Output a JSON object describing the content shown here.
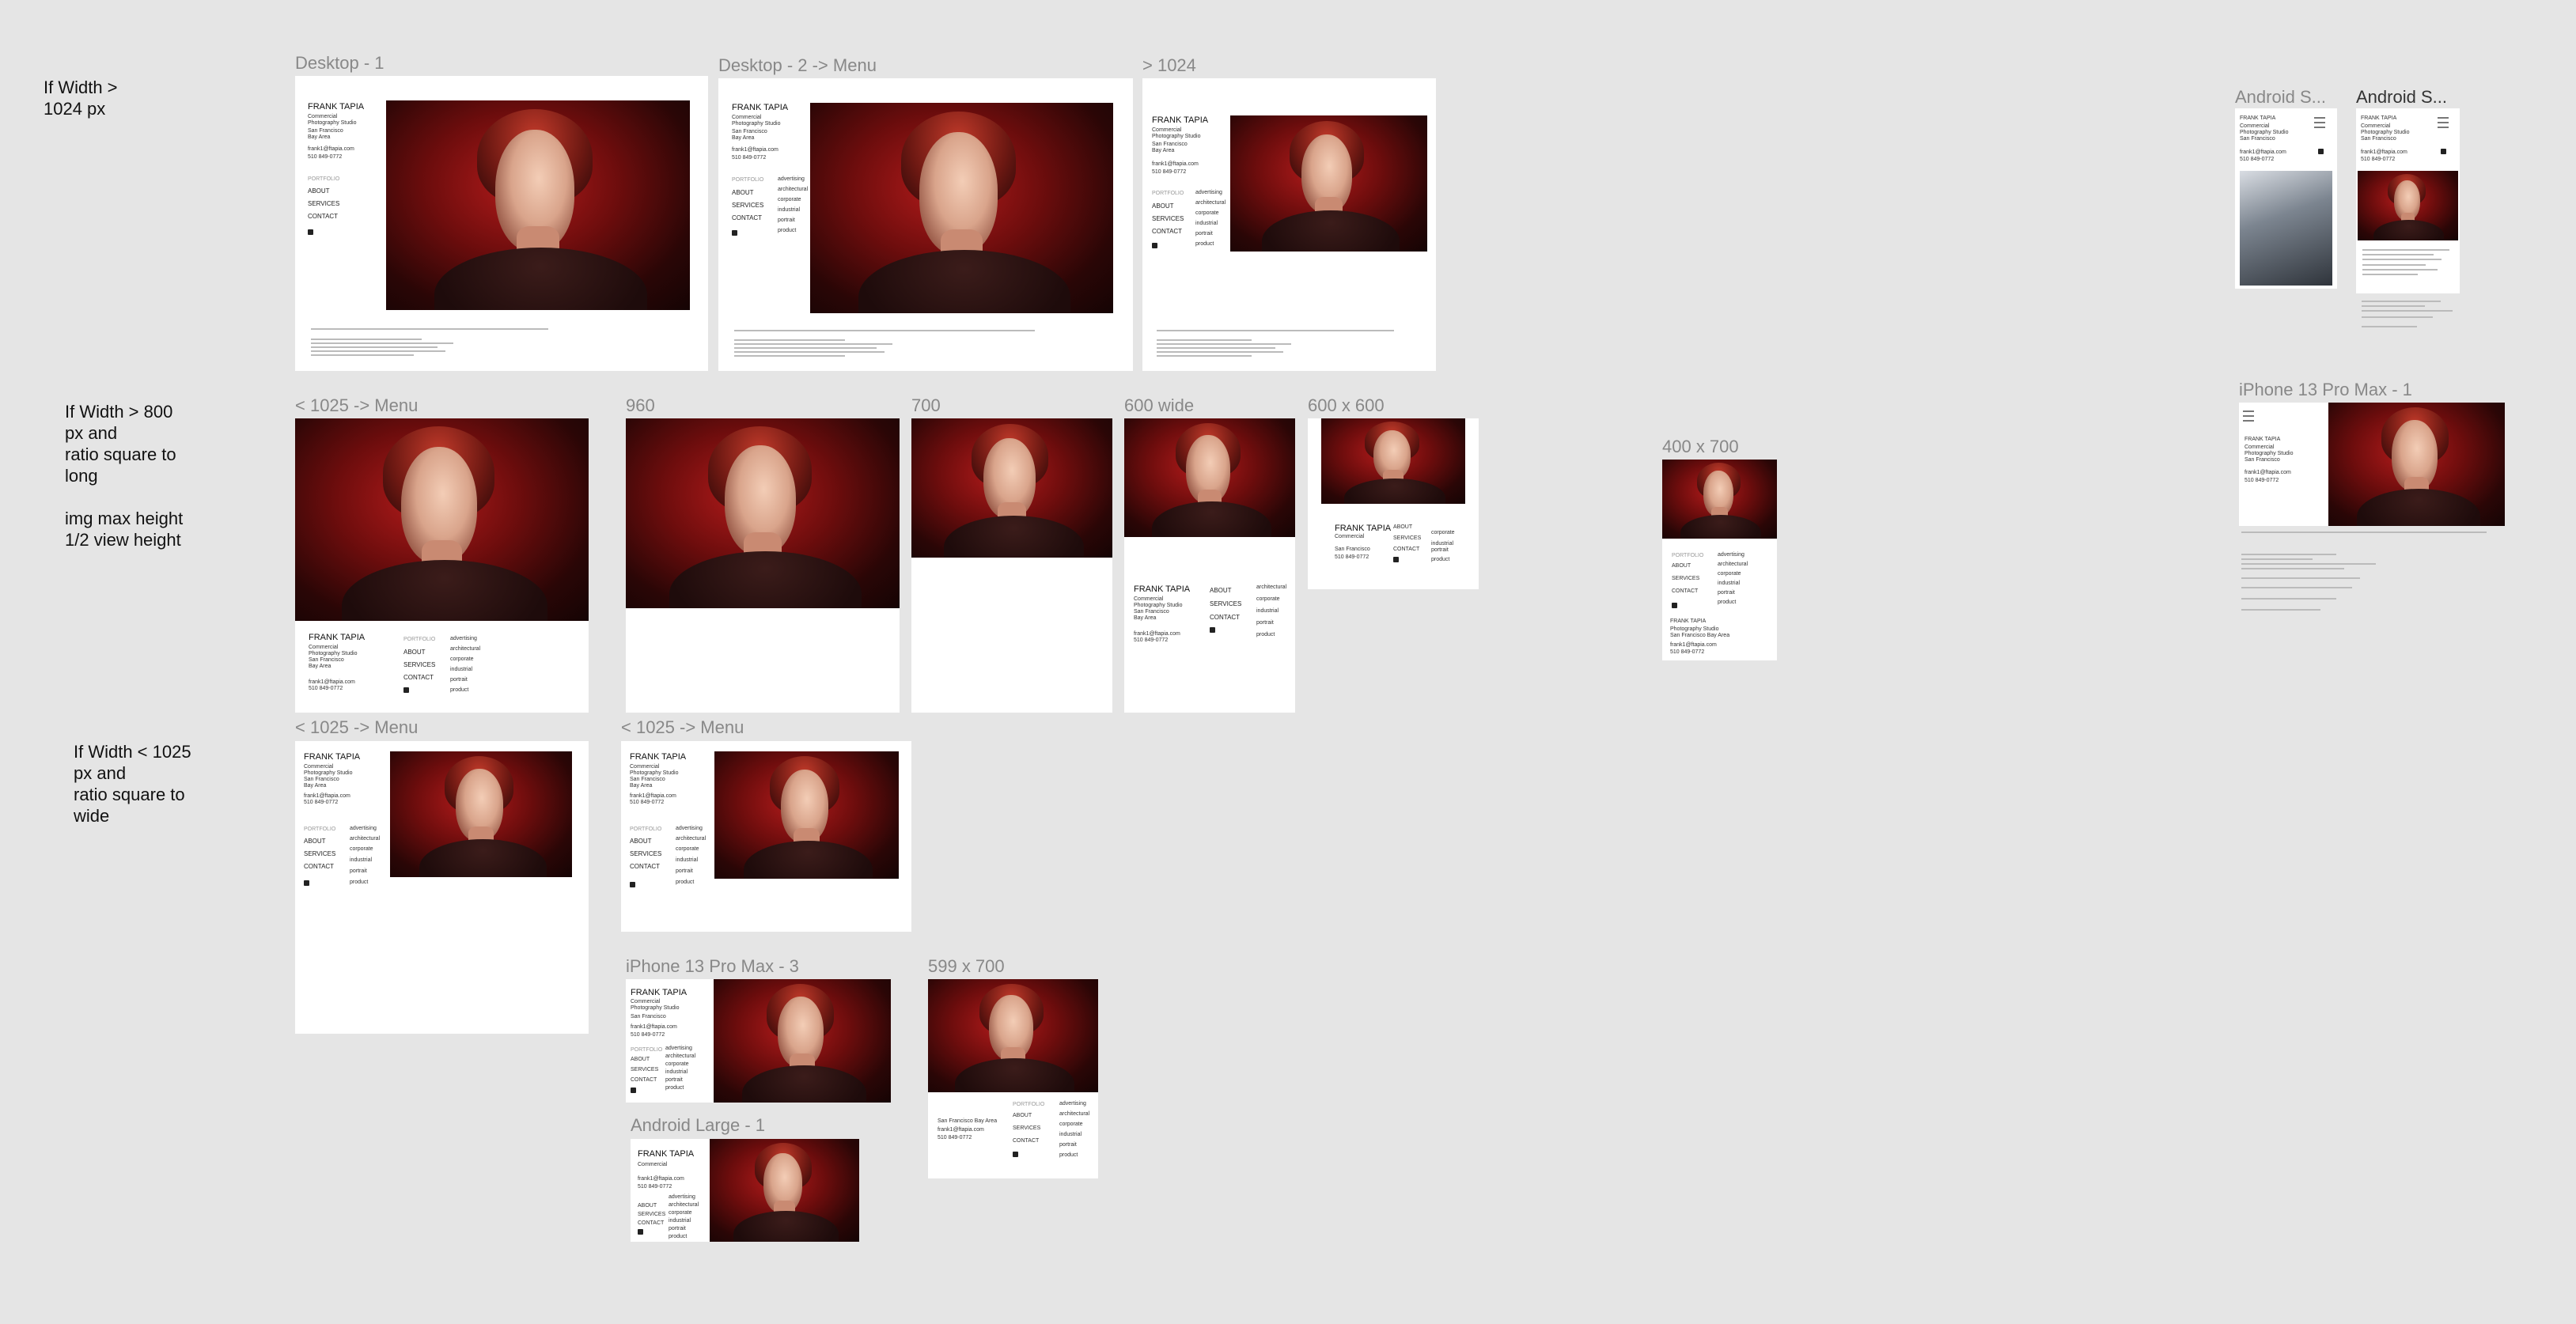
{
  "notes": {
    "n1": "If Width >\n1024 px",
    "n2": "If Width > 800\npx and\nratio square to\nlong\n\nimg max height\n1/2 view height",
    "n3": "If Width < 1025\npx and\nratio square to\nwide"
  },
  "frames": {
    "desktop1": "Desktop - 1",
    "desktop2": "Desktop - 2 -> Menu",
    "gt1024": "> 1024",
    "lt1025a": "< 1025 -> Menu",
    "f960": "960",
    "f700": "700",
    "f600wide": "600 wide",
    "f600x600": "600 x 600",
    "f400x700": "400 x 700",
    "lt1025b": "< 1025 -> Menu",
    "lt1025c": "< 1025 -> Menu",
    "iphone3": "iPhone 13 Pro Max - 3",
    "f599x700": "599 x 700",
    "androidLarge": "Android Large - 1",
    "androidS1": "Android S...",
    "androidS2": "Android S...",
    "iphone1": "iPhone 13 Pro Max - 1"
  },
  "site": {
    "name": "FRANK TAPIA",
    "tag1": "Commercial",
    "tag2": "Photography Studio",
    "city": "San Francisco",
    "area": "Bay Area",
    "cityArea": "San Francisco Bay Area",
    "email": "frank1@ftapia.com",
    "phone": "510 849-0772",
    "portfolio": "PORTFOLIO",
    "about": "ABOUT",
    "services": "SERVICES",
    "contact": "CONTACT",
    "cats": [
      "advertising",
      "architectural",
      "corporate",
      "industrial",
      "portrait",
      "product"
    ]
  }
}
